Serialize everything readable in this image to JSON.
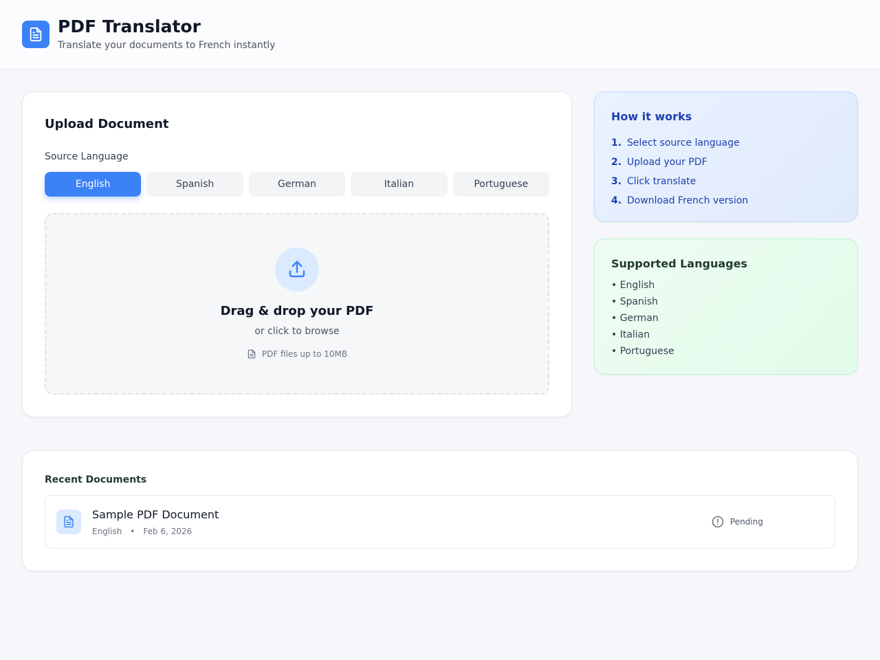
{
  "header": {
    "title": "PDF Translator",
    "subtitle": "Translate your documents to French instantly",
    "logo_icon": "document-icon"
  },
  "upload": {
    "title": "Upload Document",
    "source_label": "Source Language",
    "languages": [
      "English",
      "Spanish",
      "German",
      "Italian",
      "Portuguese"
    ],
    "selected_language": "English",
    "dropzone": {
      "icon": "upload-icon",
      "title": "Drag & drop your PDF",
      "subtitle": "or click to browse",
      "hint": "PDF files up to 10MB"
    }
  },
  "how_it_works": {
    "title": "How it works",
    "steps": [
      {
        "num": "1.",
        "text": "Select source language"
      },
      {
        "num": "2.",
        "text": "Upload your PDF"
      },
      {
        "num": "3.",
        "text": "Click translate"
      },
      {
        "num": "4.",
        "text": "Download French version"
      }
    ]
  },
  "supported": {
    "title": "Supported Languages",
    "items": [
      "• English",
      "• Spanish",
      "• German",
      "• Italian",
      "• Portuguese"
    ]
  },
  "recent": {
    "title": "Recent Documents",
    "documents": [
      {
        "name": "Sample PDF Document",
        "language": "English",
        "separator": "•",
        "date": "Feb 6, 2026",
        "status": "Pending",
        "status_icon": "clock-alert-icon"
      }
    ]
  },
  "colors": {
    "accent": "#3b82f6",
    "accent_light": "#dbeafe",
    "how_text": "#1e40af"
  }
}
